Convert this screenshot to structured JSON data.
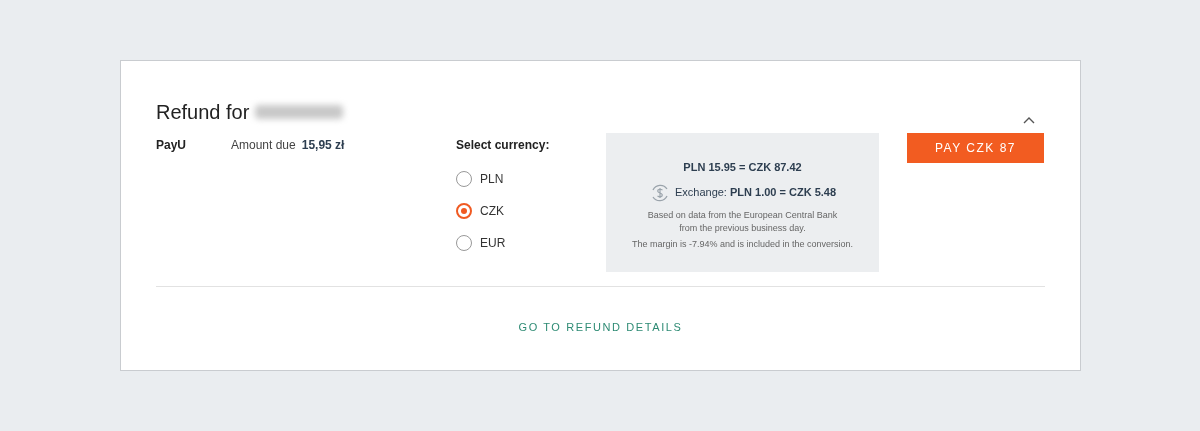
{
  "card": {
    "title": "Refund for",
    "name_redacted": true,
    "expanded": true
  },
  "payment": {
    "provider": "PayU",
    "amount_label": "Amount due",
    "amount": "15,95 zł"
  },
  "currency": {
    "label": "Select currency:",
    "options": [
      {
        "label": "PLN",
        "selected": false
      },
      {
        "label": "CZK",
        "selected": true
      },
      {
        "label": "EUR",
        "selected": false
      }
    ]
  },
  "conversion": {
    "result": "PLN 15.95 = CZK 87.42",
    "rate": "Exchange: **PLN 1.00 = CZK 5.48**",
    "source": "Based on data from the European Central Bank from the previous business day.",
    "margin": "The margin is -7.94% and is included in the conversion."
  },
  "pay_button": "PAY CZK 87",
  "details_link": "GO TO REFUND DETAILS"
}
